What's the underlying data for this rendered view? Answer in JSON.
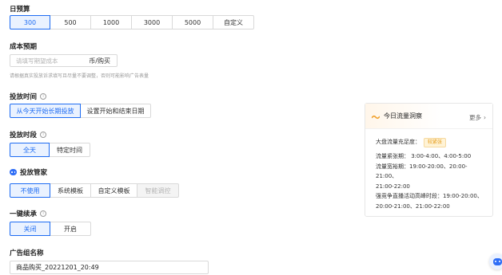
{
  "daily_budget": {
    "title": "日预算",
    "options": [
      "300",
      "500",
      "1000",
      "3000",
      "5000",
      "自定义"
    ],
    "selected_index": 0
  },
  "cost_target": {
    "title": "成本预期",
    "placeholder": "请填写期望成本",
    "unit": "币/购买",
    "hint": "请根据真实投放诉求填写且尽量不要调整，否则可能影响广告表量"
  },
  "delivery_time": {
    "title": "投放时间",
    "options": [
      "从今天开始长期投放",
      "设置开始和结束日期"
    ],
    "selected_index": 0
  },
  "delivery_period": {
    "title": "投放时段",
    "options": [
      "全天",
      "特定时间"
    ],
    "selected_index": 0
  },
  "delivery_manager": {
    "title": "投放管家",
    "options": [
      "不使用",
      "系统模板",
      "自定义模板",
      "智能调控"
    ],
    "selected_index": 0,
    "disabled_index": 3
  },
  "one_click_renew": {
    "title": "一键续承",
    "options": [
      "关闭",
      "开启"
    ],
    "selected_index": 0
  },
  "ad_group_name": {
    "title": "广告组名称",
    "value": "商品购买_20221201_20:49"
  },
  "traffic_card": {
    "title": "今日流量洞察",
    "more_label": "更多",
    "adequacy_label": "大盘流量充足度：",
    "adequacy_badge": "较紧张",
    "tight_line_1": "流量紧张期： 3:00-4:00、4:00-5:00",
    "loose_line_1": "流量宽裕期：19:00-20:00、20:00-21:00、",
    "loose_line_2": "21:00-22:00",
    "peak_line_1": "强竞争直播活动高峰时段：19:00-20:00、",
    "peak_line_2": "20:00-21:00、21:00-22:00"
  },
  "colors": {
    "accent": "#1e6cf2",
    "accent_bg": "#eaf2ff",
    "badge_text": "#e59b1a",
    "badge_bg": "#fff3d6"
  }
}
